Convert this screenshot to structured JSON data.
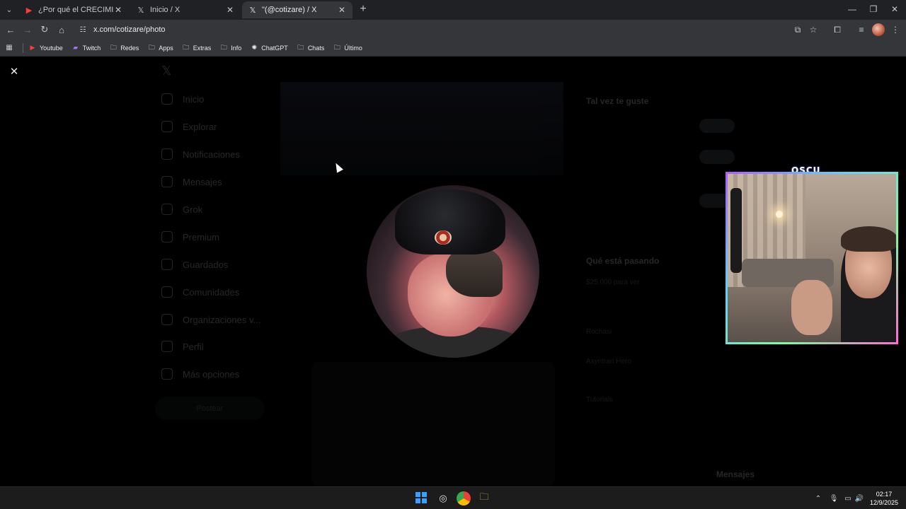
{
  "browser": {
    "tabs": [
      {
        "title": "¿Por qué el CRECIMIENTO no E",
        "favicon": "youtube-icon",
        "active": false
      },
      {
        "title": "Inicio / X",
        "favicon": "x-icon",
        "active": false
      },
      {
        "title": "\"(@cotizare) / X",
        "favicon": "x-icon",
        "active": true
      }
    ],
    "url": "x.com/cotizare/photo",
    "bookmarks": [
      {
        "label": "Youtube",
        "icon": "youtube-icon"
      },
      {
        "label": "Twitch",
        "icon": "twitch-icon"
      },
      {
        "label": "Redes",
        "icon": "folder-icon"
      },
      {
        "label": "Apps",
        "icon": "folder-icon"
      },
      {
        "label": "Extras",
        "icon": "folder-icon"
      },
      {
        "label": "Info",
        "icon": "folder-icon"
      },
      {
        "label": "ChatGPT",
        "icon": "chatgpt-icon"
      },
      {
        "label": "Chats",
        "icon": "folder-icon"
      },
      {
        "label": "Último",
        "icon": "folder-icon"
      }
    ]
  },
  "page": {
    "background_nav": [
      "Inicio",
      "Explorar",
      "Notificaciones",
      "Mensajes",
      "Grok",
      "Premium",
      "Guardados",
      "Comunidades",
      "Organizaciones v...",
      "Perfil",
      "Más opciones"
    ],
    "post_button": "Postear",
    "right_panel": {
      "section1_title": "Tal vez te guste",
      "section2_title": "Qué está pasando",
      "trends": [
        "$25.000 para ver",
        "Rochasi",
        "Asyntran Hero",
        "Tutorials"
      ]
    },
    "bottom_bar": "Mensajes"
  },
  "stream_overlay": {
    "label": "OSCU"
  },
  "taskbar": {
    "time": "02:17",
    "date": "12/9/2025"
  }
}
